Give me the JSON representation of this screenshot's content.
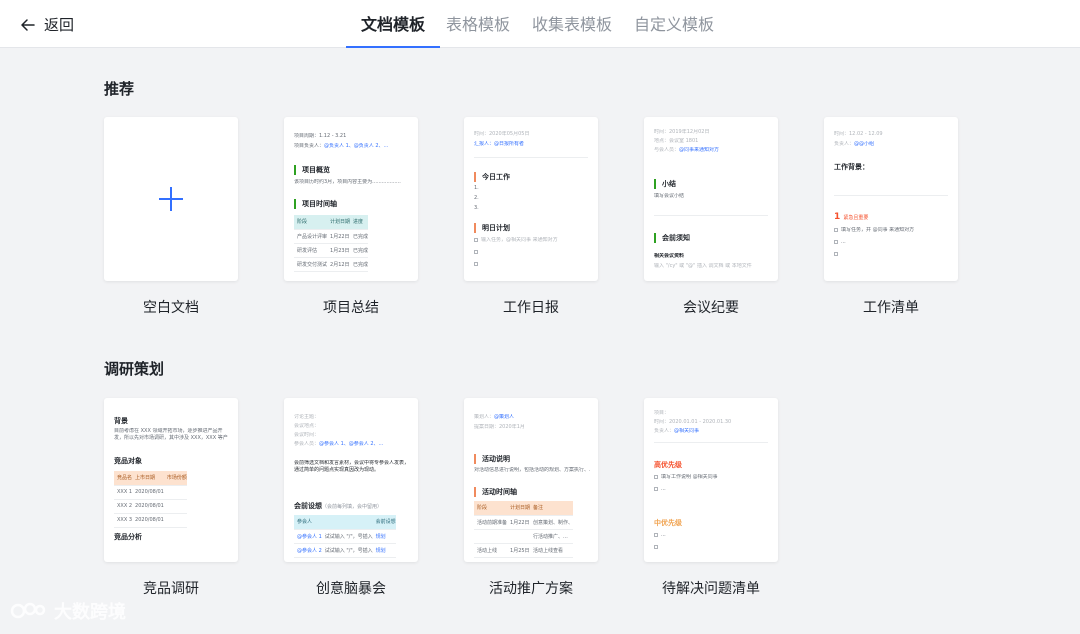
{
  "header": {
    "back_label": "返回",
    "tabs": [
      "文档模板",
      "表格模板",
      "收集表模板",
      "自定义模板"
    ]
  },
  "sections": {
    "recommend": {
      "title": "推荐",
      "cards": [
        "空白文档",
        "项目总结",
        "工作日报",
        "会议纪要",
        "工作清单"
      ]
    },
    "research": {
      "title": "调研策划",
      "cards": [
        "竞品调研",
        "创意脑暴会",
        "活动推广方案",
        "待解决问题清单"
      ]
    }
  },
  "previews": {
    "project": {
      "line1": "项目周期：1.12 - 3.21",
      "line2_prefix": "项目负责人：",
      "line2_people": "@负责人 1、@负责人 2、...",
      "h1": "项目概览",
      "desc": "该项目历时约3月，项目内容主要为..................",
      "h2": "项目时间轴",
      "table": [
        [
          "阶段",
          "计划日期",
          "进度"
        ],
        [
          "产品设计评审",
          "1月22日",
          "已完成"
        ],
        [
          "研发评估",
          "1月23日",
          "已完成"
        ],
        [
          "研发交付测试",
          "2月12日",
          "已完成"
        ]
      ]
    },
    "daily": {
      "time": "时间：2020年05月05日",
      "reporter": "汇报人：@日报所有者",
      "h1": "今日工作",
      "items": [
        "1.",
        "2.",
        "3."
      ],
      "h2": "明日计划",
      "todo": "输入任务，@相关同事 来通知对方"
    },
    "meeting": {
      "time": "时间：2019年12月02日",
      "place": "地点：会议室 1801",
      "attendees_prefix": "与会人员：",
      "attendees": "@同事来通知对方",
      "h1": "小结",
      "h1_desc": "填写会议小结",
      "h2": "会前须知",
      "material": "相关会议资料",
      "material_desc": "输入 \"/cy\" 或 \"@\" 插入 调文档 或 本地文件"
    },
    "checklist": {
      "time": "时间：12.02 - 12.09",
      "owner_prefix": "负责人：",
      "owner": "@@小组",
      "h1": "工作背景：",
      "number": "1",
      "priority": "紧急且重要",
      "item1": "填写任务，并 @同事 来通知对方",
      "item2": "..."
    },
    "competitor": {
      "h1": "背景",
      "desc": "目前考虑在 XXX 领域开拓市场，逐步推进产品开发，所以先对市场调研，其中涉及 XXX，XXX 等产品。",
      "h2": "竞品对象",
      "table": [
        [
          "竞品名",
          "上市日期",
          "市场份额"
        ],
        [
          "XXX 1",
          "2020/08/01",
          ""
        ],
        [
          "XXX 2",
          "2020/08/01",
          ""
        ],
        [
          "XXX 3",
          "2020/08/01",
          ""
        ]
      ],
      "h3": "竞品分析"
    },
    "brainstorm": {
      "l1": "讨论主题：",
      "l2": "会议地点：",
      "l3": "会议时间：",
      "l4_prefix": "参会人员：",
      "l4": "@参会人 1、@参会人 2、...",
      "note": "会前筛选文档和发言素材，会议中将专参会人发表，通过简单的问题点实现真因改为现动。",
      "h1": "会前设想",
      "h1_note": "（会前每列填，会中留用）",
      "table": [
        [
          "参会人",
          "",
          "会前设想"
        ],
        [
          "@参会人 1",
          "试试输入 \"/\"，号插入",
          "规划"
        ],
        [
          "@参会人 2",
          "试试输入 \"/\"，号插入",
          "规划"
        ]
      ]
    },
    "campaign": {
      "owner_prefix": "策划人：",
      "owner": "@策划人",
      "date": "提案日期：2020年1月",
      "h1": "活动说明",
      "desc": "对活动信息进行说明，包括活动的规划、方案执行、...",
      "h2": "活动时间轴",
      "table": [
        [
          "阶段",
          "计划日期",
          "备注"
        ],
        [
          "活动前期准备",
          "1月22日",
          "创意策划、制作、"
        ],
        [
          "",
          "",
          "行活动推广、..."
        ],
        [
          "活动上线",
          "1月25日",
          "活动上线查看"
        ]
      ]
    },
    "issues": {
      "l1": "项目：",
      "l2": "时间：2020.01.01 - 2020.01.30",
      "owner_prefix": "负责人：",
      "owner": "@相关同事",
      "high": "高优先级",
      "high_item": "填写工作说明 @相关同事",
      "dots": "...",
      "mid": "中优先级",
      "mid_item": "..."
    }
  },
  "watermark": "大数跨境",
  "colors": {
    "accent": "#3370ff",
    "page_bg": "#f2f3f5",
    "green_bar": "#2ea121",
    "orange_bar": "#f08a5d",
    "high_priority": "#f5502c",
    "mid_priority": "#f0a24f"
  }
}
